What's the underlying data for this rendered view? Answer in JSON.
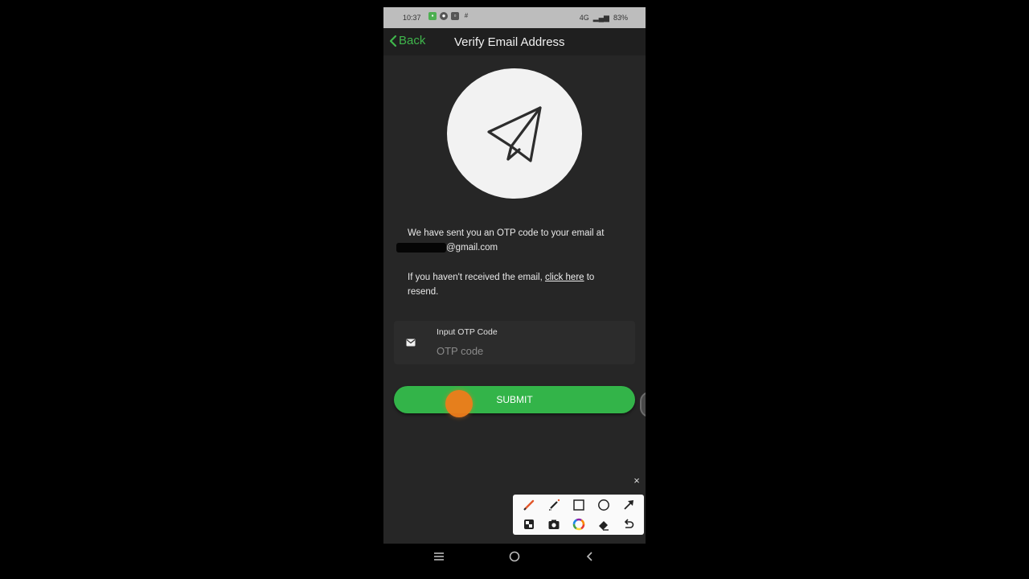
{
  "status_bar": {
    "time": "10:37",
    "network": "4G",
    "battery": "83%"
  },
  "app_bar": {
    "back_label": "Back",
    "title": "Verify Email Address"
  },
  "content": {
    "sent_message": "We have sent you an OTP code to your email at",
    "email_suffix": "@gmail.com",
    "resend_prefix": "If you haven't received the email, ",
    "resend_link": "click here",
    "resend_suffix": " to resend."
  },
  "otp": {
    "label": "Input OTP Code",
    "placeholder": "OTP code",
    "value": ""
  },
  "submit_label": "SUBMIT",
  "toolbar": {
    "close_label": "×",
    "tools": [
      "pen-icon",
      "highlighter-icon",
      "rectangle-icon",
      "circle-icon",
      "arrow-icon",
      "mosaic-icon",
      "camera-icon",
      "color-wheel-icon",
      "eraser-icon",
      "undo-icon"
    ]
  },
  "colors": {
    "accent": "#33b449",
    "background": "#262626",
    "touch_indicator": "#f07d1a"
  }
}
